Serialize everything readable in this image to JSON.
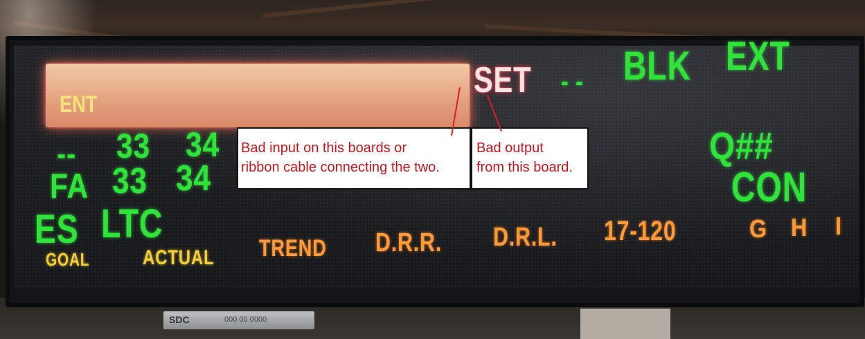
{
  "sign": {
    "ent": "ENT",
    "set": "SET",
    "dash": "- -",
    "blk": "BLK",
    "ext": "EXT",
    "row1": {
      "dashes": "--",
      "a": "33",
      "b": "34"
    },
    "row2": {
      "fa": "FA",
      "a": "33",
      "b": "34"
    },
    "row3": {
      "es": "ES",
      "ltc": "LTC"
    },
    "qhash": "Q##",
    "con": "CON",
    "labels": {
      "goal": "GOAL",
      "actual": "ACTUAL",
      "trend": "TREND",
      "drr": "D.R.R.",
      "drl": "D.R.L.",
      "range": "17-120",
      "g": "G",
      "h": "H",
      "i": "I"
    },
    "plate": {
      "brand": "SDC",
      "serial": "000 00 0000"
    }
  },
  "callouts": {
    "input_line1": "Bad input on this boards or",
    "input_line2": "ribbon cable connecting the two.",
    "output_line1": "Bad output",
    "output_line2": "from this board."
  },
  "colors": {
    "led_green": "#2fe33a",
    "led_orange": "#ff9a3a",
    "led_yellow": "#f2cf3a",
    "annotation_red": "#c4161c"
  }
}
